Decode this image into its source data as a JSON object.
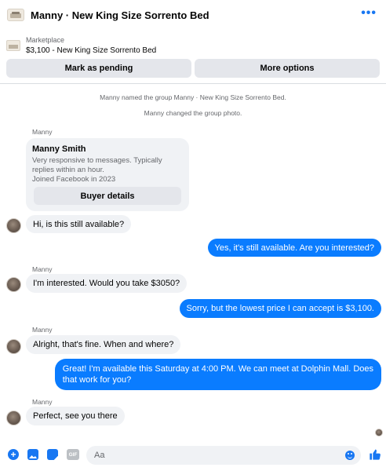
{
  "header": {
    "title": "Manny · New King Size Sorrento Bed",
    "more_icon": "ellipsis-icon",
    "accent_color": "#1877f2"
  },
  "listing": {
    "label": "Marketplace",
    "price_title": "$3,100 - New King Size Sorrento Bed"
  },
  "actions": {
    "mark_pending": "Mark as pending",
    "more_options": "More options"
  },
  "system_messages": [
    "Manny named the group Manny · New King Size Sorrento Bed.",
    "Manny changed the group photo."
  ],
  "seller_card": {
    "sender": "Manny",
    "name": "Manny Smith",
    "description_line1": "Very responsive to messages. Typically",
    "description_line2": "replies within an hour.",
    "description_line3": "Joined Facebook in 2023",
    "button": "Buyer details"
  },
  "messages": [
    {
      "from": "Manny",
      "direction": "in",
      "text": "Hi, is this still available?"
    },
    {
      "from": "me",
      "direction": "out",
      "text": "Yes, it's still available. Are you interested?"
    },
    {
      "from": "Manny",
      "direction": "in",
      "sender_label": "Manny",
      "text": "I'm interested. Would you take $3050?"
    },
    {
      "from": "me",
      "direction": "out",
      "text": "Sorry, but the lowest price I can accept is $3,100."
    },
    {
      "from": "Manny",
      "direction": "in",
      "sender_label": "Manny",
      "text": "Alright, that's fine. When and where?"
    },
    {
      "from": "me",
      "direction": "out",
      "text_line1": "Great! I'm available this Saturday at 4:00 PM. We can meet at Dolphin Mall. Does",
      "text_line2": "that work for you?"
    },
    {
      "from": "Manny",
      "direction": "in",
      "sender_label": "Manny",
      "text": "Perfect, see you there"
    }
  ],
  "composer": {
    "placeholder": "Aa",
    "gif_label": "GIF",
    "icons": [
      "plus-icon",
      "photo-icon",
      "sticker-icon",
      "gif-icon",
      "emoji-icon",
      "thumbs-up-icon"
    ]
  },
  "colors": {
    "outgoing_bubble": "#0a7cff",
    "incoming_bubble": "#f0f2f5",
    "secondary_text": "#65676b"
  }
}
